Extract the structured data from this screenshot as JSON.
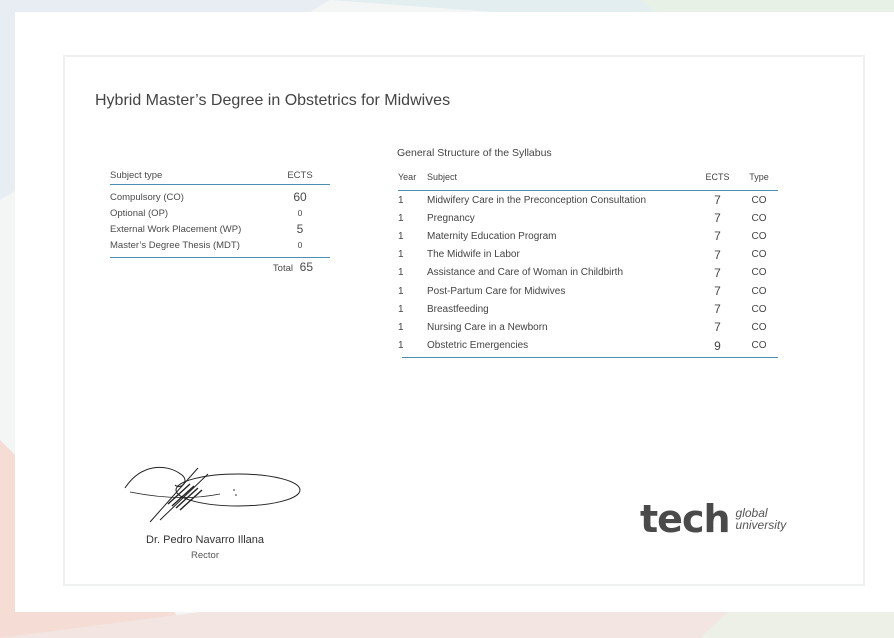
{
  "header": {
    "title": "Hybrid Master’s Degree in Obstetrics for Midwives"
  },
  "subject_types": {
    "col_type": "Subject type",
    "col_ects": "ECTS",
    "rows": [
      {
        "label": "Compulsory (CO)",
        "value": "60"
      },
      {
        "label": "Optional (OP)",
        "value": "0"
      },
      {
        "label": "External Work Placement (WP)",
        "value": "5"
      },
      {
        "label": "Master’s Degree Thesis (MDT)",
        "value": "0"
      }
    ],
    "total_label": "Total",
    "total_value": "65"
  },
  "syllabus": {
    "title": "General Structure of the Syllabus",
    "col_year": "Year",
    "col_subject": "Subject",
    "col_ects": "ECTS",
    "col_type": "Type",
    "rows": [
      {
        "year": "1",
        "subject": "Midwifery Care in the Preconception Consultation",
        "ects": "7",
        "type": "CO"
      },
      {
        "year": "1",
        "subject": "Pregnancy",
        "ects": "7",
        "type": "CO"
      },
      {
        "year": "1",
        "subject": "Maternity Education Program",
        "ects": "7",
        "type": "CO"
      },
      {
        "year": "1",
        "subject": "The Midwife in Labor",
        "ects": "7",
        "type": "CO"
      },
      {
        "year": "1",
        "subject": "Assistance and Care of Woman in Childbirth",
        "ects": "7",
        "type": "CO"
      },
      {
        "year": "1",
        "subject": "Post-Partum Care for Midwives",
        "ects": "7",
        "type": "CO"
      },
      {
        "year": "1",
        "subject": "Breastfeeding",
        "ects": "7",
        "type": "CO"
      },
      {
        "year": "1",
        "subject": "Nursing Care in a Newborn",
        "ects": "7",
        "type": "CO"
      },
      {
        "year": "1",
        "subject": "Obstetric Emergencies",
        "ects": "9",
        "type": "CO"
      }
    ]
  },
  "signature": {
    "name": "Dr. Pedro Navarro Illana",
    "role": "Rector"
  },
  "logo": {
    "main": "tech",
    "line1": "global",
    "line2": "university"
  },
  "colors": {
    "accent_line": "#4b8fb0",
    "logo_text": "#4a4a4a",
    "logo_accent": "#34b3b7"
  }
}
